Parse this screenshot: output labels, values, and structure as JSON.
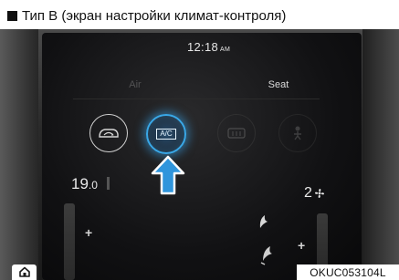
{
  "section": {
    "title": "Тип B (экран настройки климат-контроля)"
  },
  "status": {
    "time": "12:18",
    "ampm": "AM"
  },
  "tabs": [
    {
      "label": "Air"
    },
    {
      "label": "Seat"
    }
  ],
  "controls": {
    "recirc_icon": "air-recirculation-icon",
    "ac_label": "A/C",
    "defrost_icon": "defrost-icon",
    "fan_icon": "fan-direction-icon",
    "ac_state": "active",
    "ac_color": "#39a8e8"
  },
  "climate": {
    "temperature": "19",
    "temperature_decimal": ".0",
    "fan_level": "2"
  },
  "figure_code": "OKUC053104L"
}
